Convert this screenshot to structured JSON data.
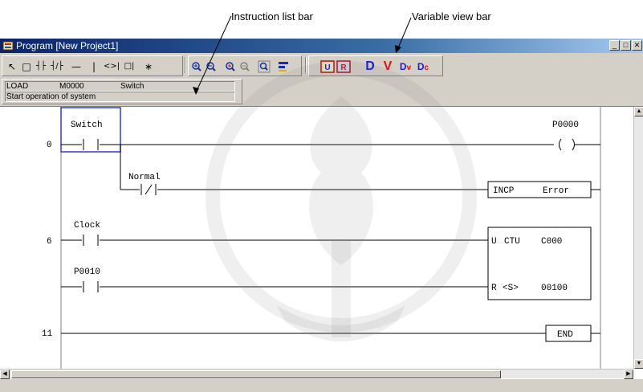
{
  "annotations": {
    "instruction_list_bar": "Instruction list bar",
    "variable_view_bar": "Variable view bar"
  },
  "window": {
    "title": "Program [New Project1]",
    "icon": "program-icon",
    "controls": [
      "minimize-icon",
      "maximize-icon",
      "close-icon"
    ]
  },
  "toolbar": {
    "groups": [
      {
        "name": "ladder-tools",
        "items": [
          "select-arrow-icon",
          "box-icon",
          "no-contact-icon",
          "nc-contact-icon",
          "horizontal-line-icon",
          "vertical-line-icon",
          "coil-icon",
          "function-block-icon",
          "inverter-icon"
        ]
      },
      {
        "name": "zoom-tools",
        "items": [
          "zoom-in-icon",
          "zoom-out-icon",
          "zoom-in-alt-icon",
          "zoom-out-alt-icon",
          "zoom-fit-icon",
          "comment-icon"
        ]
      },
      {
        "name": "view-tools",
        "items": [
          "U",
          "R",
          "D",
          "V",
          "D/",
          "Dc"
        ]
      }
    ],
    "view_labels": {
      "D": "D",
      "V": "V",
      "Dv": "D",
      "Dc": "D"
    },
    "colors": {
      "blue_letter": "#1a1ad8",
      "red_letter": "#e01010"
    }
  },
  "instruction_bar": {
    "instruction": "LOAD",
    "operand": "M0000",
    "variable": "Switch",
    "comment": "Start operation of system"
  },
  "ladder": {
    "steps": [
      "0",
      "6",
      "11"
    ],
    "contacts": [
      {
        "label": "Switch",
        "type": "NO"
      },
      {
        "label": "Normal",
        "type": "NC"
      },
      {
        "label": "Clock",
        "type": "NO"
      },
      {
        "label": "P0010",
        "type": "NO"
      }
    ],
    "coil": {
      "label": "P0000"
    },
    "incp": {
      "op": "INCP",
      "operand": "Error"
    },
    "counter": {
      "u": "U",
      "op": "CTU",
      "name": "C000",
      "r": "R",
      "s": "<S>",
      "preset": "00100"
    },
    "end": "END"
  },
  "colors": {
    "selection": "#2f3bd0",
    "rail": "#000000",
    "chrome": "#d4d0c8"
  }
}
